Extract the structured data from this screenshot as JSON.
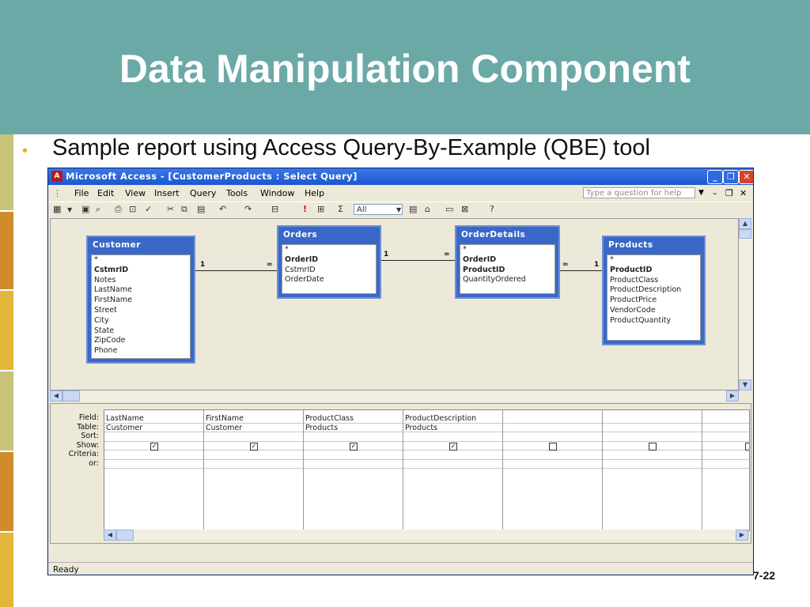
{
  "slide": {
    "title": "Data Manipulation Component",
    "bullet": "Sample report using Access Query-By-Example (QBE) tool",
    "page_number": "7-22",
    "colors": {
      "title_bg": "#6aa9a6",
      "stripes": [
        "#c9c37a",
        "#d08b2a",
        "#e2b53b",
        "#c9c37a",
        "#d08b2a"
      ]
    }
  },
  "window": {
    "title": "Microsoft Access - [CustomerProducts : Select Query]",
    "app_icon": "access-icon",
    "menu": [
      "File",
      "Edit",
      "View",
      "Insert",
      "Query",
      "Tools",
      "Window",
      "Help"
    ],
    "help_placeholder": "Type a question for help",
    "toolbar": {
      "combo_value": "All",
      "sigma": "Σ",
      "exclaim": "!"
    },
    "status": "Ready"
  },
  "tables": [
    {
      "name": "Customer",
      "fields": [
        "*",
        "CstmrID",
        "Notes",
        "LastName",
        "FirstName",
        "Street",
        "City",
        "State",
        "ZipCode",
        "Phone"
      ],
      "key": [
        "CstmrID"
      ]
    },
    {
      "name": "Orders",
      "fields": [
        "*",
        "OrderID",
        "CstmrID",
        "OrderDate"
      ],
      "key": [
        "OrderID"
      ]
    },
    {
      "name": "OrderDetails",
      "fields": [
        "*",
        "OrderID",
        "ProductID",
        "QuantityOrdered"
      ],
      "key": [
        "OrderID",
        "ProductID"
      ]
    },
    {
      "name": "Products",
      "fields": [
        "*",
        "ProductID",
        "ProductClass",
        "ProductDescription",
        "ProductPrice",
        "VendorCode",
        "ProductQuantity"
      ],
      "key": [
        "ProductID"
      ]
    }
  ],
  "joins": [
    {
      "one": "1",
      "many": "∞"
    },
    {
      "one": "1",
      "many": "∞"
    },
    {
      "one": "1",
      "many": "∞"
    }
  ],
  "qbe": {
    "row_labels": [
      "Field:",
      "Table:",
      "Sort:",
      "Show:",
      "Criteria:",
      "or:"
    ],
    "columns": [
      {
        "field": "LastName",
        "table": "Customer",
        "show": true
      },
      {
        "field": "FirstName",
        "table": "Customer",
        "show": true
      },
      {
        "field": "ProductClass",
        "table": "Products",
        "show": true
      },
      {
        "field": "ProductDescription",
        "table": "Products",
        "show": true
      },
      {
        "field": "",
        "table": "",
        "show": false
      },
      {
        "field": "",
        "table": "",
        "show": false
      },
      {
        "field": "",
        "table": "",
        "show": false
      }
    ]
  }
}
